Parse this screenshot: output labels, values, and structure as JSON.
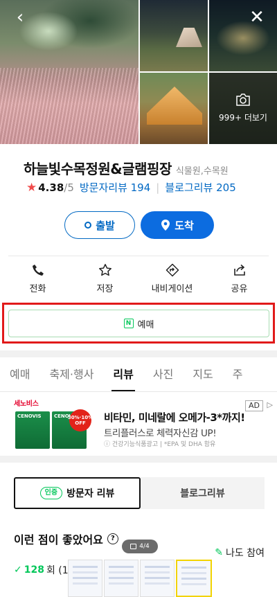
{
  "gallery": {
    "more_label": "999+ 더보기"
  },
  "place": {
    "name": "하늘빛수목정원&글램핑장",
    "category": "식물원,수목원",
    "rating": "4.38",
    "rating_max": "/5",
    "visitor_reviews": "방문자리뷰 194",
    "blog_reviews": "블로그리뷰 205"
  },
  "route": {
    "depart_label": "출발",
    "arrive_label": "도착"
  },
  "actions": [
    {
      "label": "전화",
      "icon": "phone-icon"
    },
    {
      "label": "저장",
      "icon": "star-icon"
    },
    {
      "label": "내비게이션",
      "icon": "navigation-icon"
    },
    {
      "label": "공유",
      "icon": "share-icon"
    }
  ],
  "reserve": {
    "label": "예매",
    "icon_text": "N"
  },
  "tabs": [
    "예매",
    "축제·행사",
    "리뷰",
    "사진",
    "지도",
    "주"
  ],
  "active_tab": "리뷰",
  "ad": {
    "brand": "세노비스",
    "badge": "AD",
    "box1": "CENOVIS",
    "box2": "CENOVIS",
    "offer": "30%·10% OFF",
    "title": "비타민, 미네랄에 오메가-3*까지!",
    "subtitle": "트리플러스로 체력자신감 UP!",
    "note": "ⓘ 건강기능식품광고 | *EPA 및 DHA 함유"
  },
  "reviews": {
    "visitor_tab": "방문자 리뷰",
    "visitor_badge": "인증",
    "blog_tab": "블로그리뷰",
    "good_points_title": "이런 점이 좋았어요",
    "join_label": "나도 참여",
    "count": "128",
    "count_suffix": "회 (1"
  },
  "pager": {
    "text": "4/4"
  },
  "colors": {
    "accent": "#0068c3",
    "naver_green": "#03c75a",
    "highlight_red": "#e11a1a"
  }
}
